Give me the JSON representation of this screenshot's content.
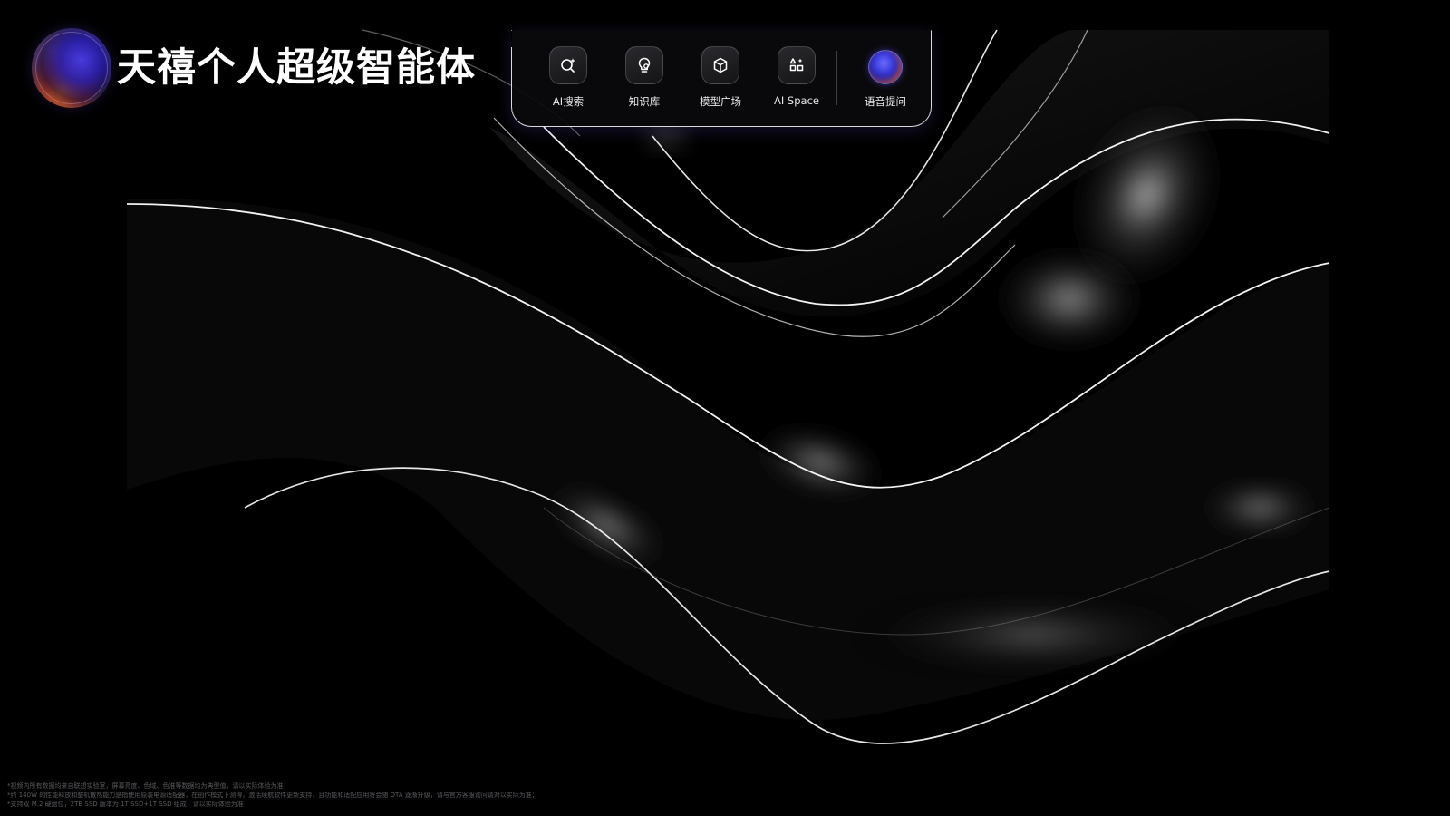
{
  "brand": {
    "title": "天禧个人超级智能体",
    "logo_icon": "gradient-orb-icon"
  },
  "toolbar": {
    "items": [
      {
        "label": "AI搜索",
        "icon": "ai-search-icon"
      },
      {
        "label": "知识库",
        "icon": "lightbulb-icon"
      },
      {
        "label": "模型广场",
        "icon": "cube-icon"
      },
      {
        "label": "AI Space",
        "icon": "apps-grid-icon"
      }
    ],
    "voice": {
      "label": "语音提问",
      "icon": "voice-orb-icon"
    }
  },
  "footnotes": [
    "*视频内所有数据均来自联想实验室，屏幕亮度、色域、色准等数据均为典型值，请以实际体验为准；",
    "*约 140W 的性能释放和整机散热能力是指使用原装电源适配器，在创作模式下测得，激活续航软件更新支持，且功能和适配应用将会随 OTA 逐渐升级，请与官方客服询问请对以实际为准；",
    "*支持双 M.2 硬盘位，2TB SSD 版本为 1T SSD+1T SSD 组成，请以实际体验为准"
  ],
  "colors": {
    "background": "#000000",
    "accent_blue": "#3b3ad8",
    "accent_orange": "#ff7a20"
  }
}
